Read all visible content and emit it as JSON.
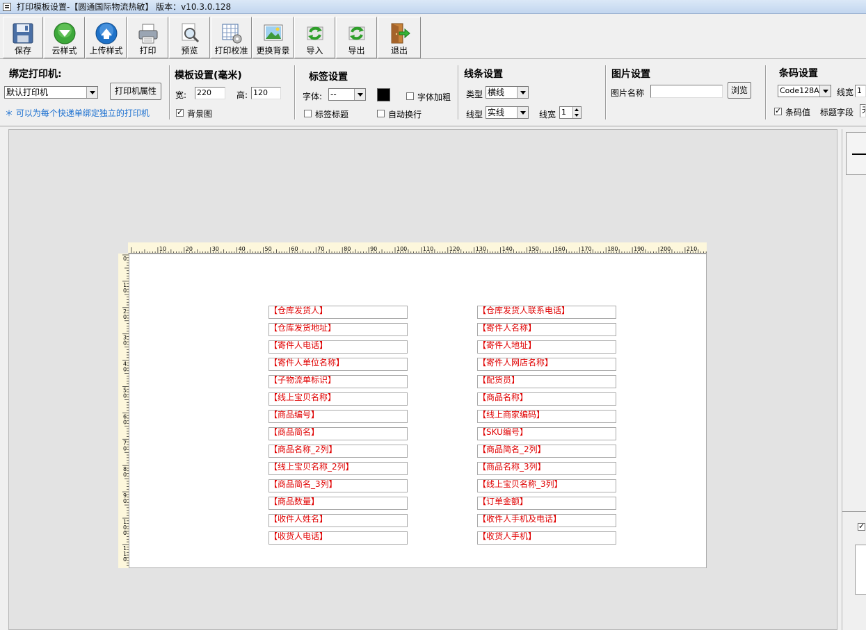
{
  "window": {
    "title": "打印模板设置-【圆通国际物流热敏】 版本：v10.3.0.128"
  },
  "toolbar": [
    {
      "name": "save-button",
      "icon": "floppy-disk-icon",
      "label": "保存"
    },
    {
      "name": "cloud-style-button",
      "icon": "green-down-arrow-icon",
      "label": "云样式"
    },
    {
      "name": "upload-style-button",
      "icon": "blue-up-arrow-icon",
      "label": "上传样式"
    },
    {
      "name": "print-button",
      "icon": "printer-icon",
      "label": "打印"
    },
    {
      "name": "preview-button",
      "icon": "magnifier-icon",
      "label": "预览"
    },
    {
      "name": "print-calibrate-button",
      "icon": "grid-gear-icon",
      "label": "打印校准"
    },
    {
      "name": "change-background-button",
      "icon": "landscape-picture-icon",
      "label": "更换背景"
    },
    {
      "name": "import-button",
      "icon": "green-refresh-icon",
      "label": "导入"
    },
    {
      "name": "export-button",
      "icon": "green-refresh-icon",
      "label": "导出"
    },
    {
      "name": "exit-button",
      "icon": "exit-door-icon",
      "label": "退出"
    }
  ],
  "printer": {
    "title": "绑定打印机:",
    "selected": "默认打印机",
    "props_button": "打印机属性",
    "hint": "＊ 可以为每个快递单绑定独立的打印机"
  },
  "template": {
    "title": "模板设置(毫米)",
    "width_label": "宽:",
    "width": "220",
    "height_label": "高:",
    "height": "120",
    "bg_label": "背景图"
  },
  "label_settings": {
    "title": "标签设置",
    "font_label": "字体:",
    "font_value": "--",
    "bold_label": "字体加粗",
    "label_title": "标签标题",
    "auto_wrap": "自动换行",
    "color": "#000000"
  },
  "line_settings": {
    "title": "线条设置",
    "type_label": "类型",
    "type_value": "横线",
    "style_label": "线型",
    "style_value": "实线",
    "width_label": "线宽",
    "width_value": "1"
  },
  "image_settings": {
    "title": "图片设置",
    "name_label": "图片名称",
    "name_value": "",
    "browse_button": "浏览"
  },
  "barcode_settings": {
    "title": "条码设置",
    "type_value": "Code128A",
    "width_label": "线宽",
    "width_value": "1",
    "show_value_label": "条码值",
    "title_field_label": "标题字段",
    "title_field_value": "无"
  },
  "ruler": {
    "h_labels": [
      "10",
      "20",
      "30",
      "40",
      "50",
      "60",
      "70",
      "80",
      "90",
      "100",
      "110",
      "120",
      "130",
      "140",
      "150",
      "160",
      "170",
      "180",
      "190",
      "200",
      "210"
    ],
    "v_labels": [
      [
        "0"
      ],
      [
        "1",
        "0"
      ],
      [
        "2",
        "0"
      ],
      [
        "3",
        "0"
      ],
      [
        "4",
        "0"
      ],
      [
        "5",
        "0"
      ],
      [
        "6",
        "0"
      ],
      [
        "7",
        "0"
      ],
      [
        "8",
        "0"
      ],
      [
        "9",
        "0"
      ],
      [
        "1",
        "0",
        "0"
      ],
      [
        "1",
        "1",
        "0"
      ]
    ]
  },
  "fields": {
    "left": [
      "【仓库发货人】",
      "【仓库发货地址】",
      "【寄件人电话】",
      "【寄件人单位名称】",
      "【子物流单标识】",
      "【线上宝贝名称】",
      "【商品编号】",
      "【商品简名】",
      "【商品名称_2列】",
      "【线上宝贝名称_2列】",
      "【商品简名_3列】",
      "【商品数量】",
      "【收件人姓名】",
      "【收货人电话】"
    ],
    "right": [
      "【仓库发货人联系电话】",
      "【寄件人名称】",
      "【寄件人地址】",
      "【寄件人网店名称】",
      "【配货员】",
      "【商品名称】",
      "【线上商家编码】",
      "【SKU编号】",
      "【商品简名_2列】",
      "【商品名称_3列】",
      "【线上宝贝名称_3列】",
      "【订单金额】",
      "【收件人手机及电话】",
      "【收货人手机】"
    ]
  },
  "colors": {
    "field_text": "#e00000",
    "hint_text": "#1a6fd0"
  }
}
